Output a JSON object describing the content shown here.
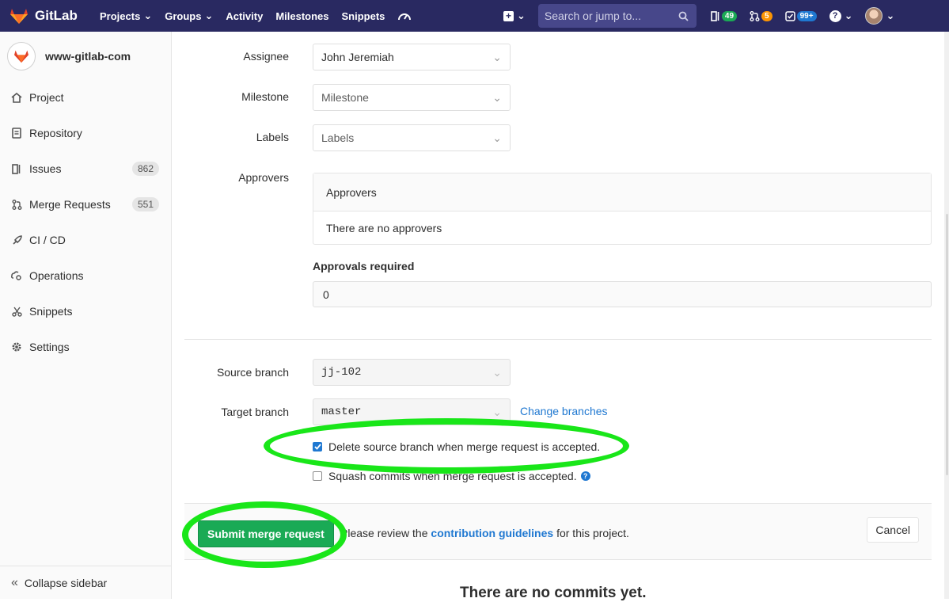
{
  "navbar": {
    "brand": "GitLab",
    "items": [
      "Projects",
      "Groups",
      "Activity",
      "Milestones",
      "Snippets"
    ],
    "search_placeholder": "Search or jump to...",
    "issues_count": "49",
    "mr_count": "5",
    "todo_count": "99+"
  },
  "sidebar": {
    "project_name": "www-gitlab-com",
    "items": [
      {
        "label": "Project",
        "icon": "home-icon"
      },
      {
        "label": "Repository",
        "icon": "doc-icon"
      },
      {
        "label": "Issues",
        "icon": "issues-icon",
        "count": "862"
      },
      {
        "label": "Merge Requests",
        "icon": "merge-request-icon",
        "count": "551"
      },
      {
        "label": "CI / CD",
        "icon": "rocket-icon"
      },
      {
        "label": "Operations",
        "icon": "cloud-gear-icon"
      },
      {
        "label": "Snippets",
        "icon": "scissors-icon"
      },
      {
        "label": "Settings",
        "icon": "gear-icon"
      }
    ],
    "collapse": "Collapse sidebar"
  },
  "form": {
    "assignee_label": "Assignee",
    "assignee_value": "John Jeremiah",
    "milestone_label": "Milestone",
    "milestone_value": "Milestone",
    "labels_label": "Labels",
    "labels_value": "Labels",
    "approvers_label": "Approvers",
    "approvers_header": "Approvers",
    "approvers_empty": "There are no approvers",
    "approvals_required_label": "Approvals required",
    "approvals_required_value": "0",
    "source_branch_label": "Source branch",
    "source_branch_value": "jj-102",
    "target_branch_label": "Target branch",
    "target_branch_value": "master",
    "change_branches": "Change branches",
    "delete_source_label": "Delete source branch when merge request is accepted.",
    "delete_source_checked": true,
    "squash_label": "Squash commits when merge request is accepted.",
    "squash_checked": false
  },
  "actions": {
    "submit": "Submit merge request",
    "review_prefix": "Please review the",
    "review_link": "contribution guidelines",
    "review_suffix": "for this project.",
    "cancel": "Cancel"
  },
  "footer_heading": "There are no commits yet.",
  "colors": {
    "navbar": "#292961",
    "accent": "#1aaa55",
    "link": "#1f78d1",
    "highlight": "#19e619"
  }
}
